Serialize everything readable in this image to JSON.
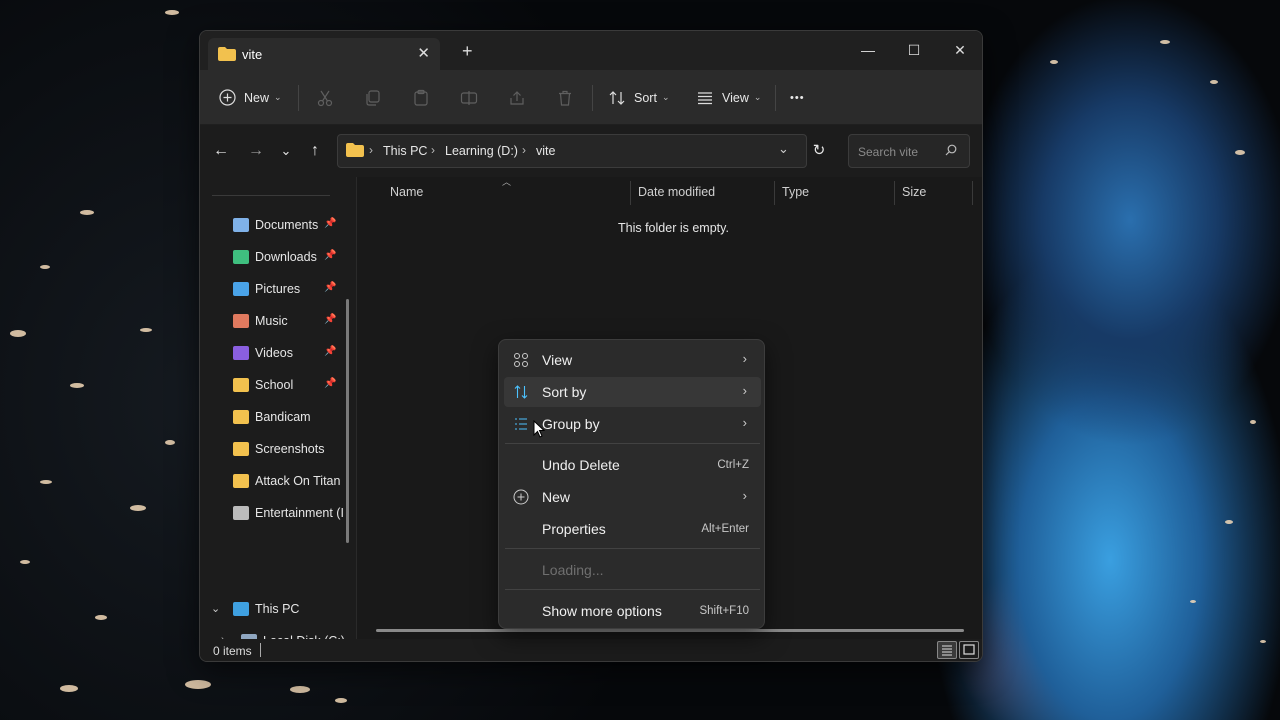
{
  "window": {
    "tab_title": "vite",
    "new_tab_symbol": "+",
    "controls": {
      "minimize": "—",
      "maximize": "☐",
      "close": "✕"
    }
  },
  "toolbar": {
    "new_label": "New",
    "sort_label": "Sort",
    "view_label": "View",
    "more_label": "•••"
  },
  "address": {
    "crumbs": [
      "This PC",
      "Learning (D:)",
      "vite"
    ],
    "search_placeholder": "Search vite"
  },
  "sidebar": {
    "items": [
      {
        "label": "Documents",
        "icon": "documents-icon",
        "pinned": true,
        "color": "#7fb1e8"
      },
      {
        "label": "Downloads",
        "icon": "download-icon",
        "pinned": true,
        "color": "#3fbf7f"
      },
      {
        "label": "Pictures",
        "icon": "pictures-icon",
        "pinned": true,
        "color": "#4aa3e8"
      },
      {
        "label": "Music",
        "icon": "music-icon",
        "pinned": true,
        "color": "#e07a5f"
      },
      {
        "label": "Videos",
        "icon": "videos-icon",
        "pinned": true,
        "color": "#8a5fe0"
      },
      {
        "label": "School",
        "icon": "folder-icon",
        "pinned": true,
        "color": "#f2c14e"
      },
      {
        "label": "Bandicam",
        "icon": "folder-icon",
        "pinned": false,
        "color": "#f2c14e"
      },
      {
        "label": "Screenshots",
        "icon": "folder-icon",
        "pinned": false,
        "color": "#f2c14e"
      },
      {
        "label": "Attack On Titan",
        "icon": "folder-icon",
        "pinned": false,
        "color": "#f2c14e"
      },
      {
        "label": "Entertainment (I",
        "icon": "drive-icon",
        "pinned": false,
        "color": "#bbbbbb"
      }
    ],
    "this_pc": "This PC",
    "local_disk": "Local Disk (C:)"
  },
  "columns": {
    "name": "Name",
    "date": "Date modified",
    "type": "Type",
    "size": "Size"
  },
  "empty_message": "This folder is empty.",
  "status": {
    "items": "0 items"
  },
  "context_menu": {
    "view": "View",
    "sort_by": "Sort by",
    "group_by": "Group by",
    "undo_delete": "Undo Delete",
    "undo_shortcut": "Ctrl+Z",
    "new": "New",
    "properties": "Properties",
    "properties_shortcut": "Alt+Enter",
    "loading": "Loading...",
    "show_more": "Show more options",
    "show_more_shortcut": "Shift+F10"
  },
  "colors": {
    "accent": "#4cc2ff",
    "folder": "#f2c14e"
  }
}
